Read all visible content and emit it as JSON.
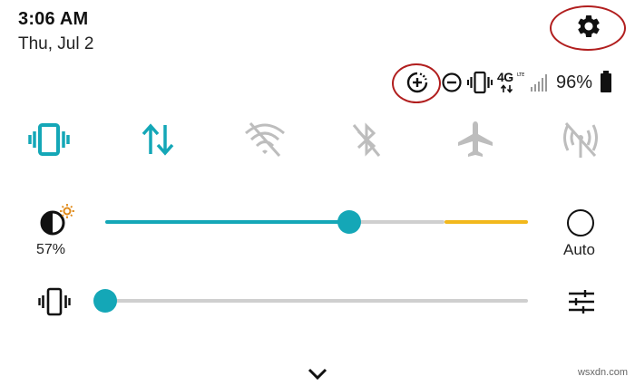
{
  "header": {
    "time": "3:06 AM",
    "date": "Thu, Jul 2"
  },
  "status_bar": {
    "icons": [
      "data-saver-icon",
      "do-not-disturb-icon",
      "vibrate-icon",
      "4g-lte-icon",
      "signal-icon"
    ],
    "network_label": "4G",
    "battery_percent": "96%"
  },
  "quick_settings": {
    "tiles": [
      {
        "name": "vibrate",
        "icon": "vibrate-icon",
        "active": true
      },
      {
        "name": "mobile-data",
        "icon": "data-arrows-icon",
        "active": true
      },
      {
        "name": "wifi",
        "icon": "wifi-off-icon",
        "active": false
      },
      {
        "name": "bluetooth",
        "icon": "bluetooth-off-icon",
        "active": false
      },
      {
        "name": "airplane-mode",
        "icon": "airplane-icon",
        "active": false
      },
      {
        "name": "hotspot",
        "icon": "hotspot-off-icon",
        "active": false
      }
    ]
  },
  "brightness": {
    "percent_label": "57%",
    "value": 0.57,
    "auto_label": "Auto"
  },
  "volume": {
    "value": 0.0
  },
  "colors": {
    "accent": "#14a7b7",
    "inactive": "#bdbdbd",
    "track": "#cfcfcf",
    "warning_range": "#f2b81c",
    "annotation": "#b11e1e",
    "sun": "#e08a1a"
  },
  "watermark": "wsxdn.com"
}
